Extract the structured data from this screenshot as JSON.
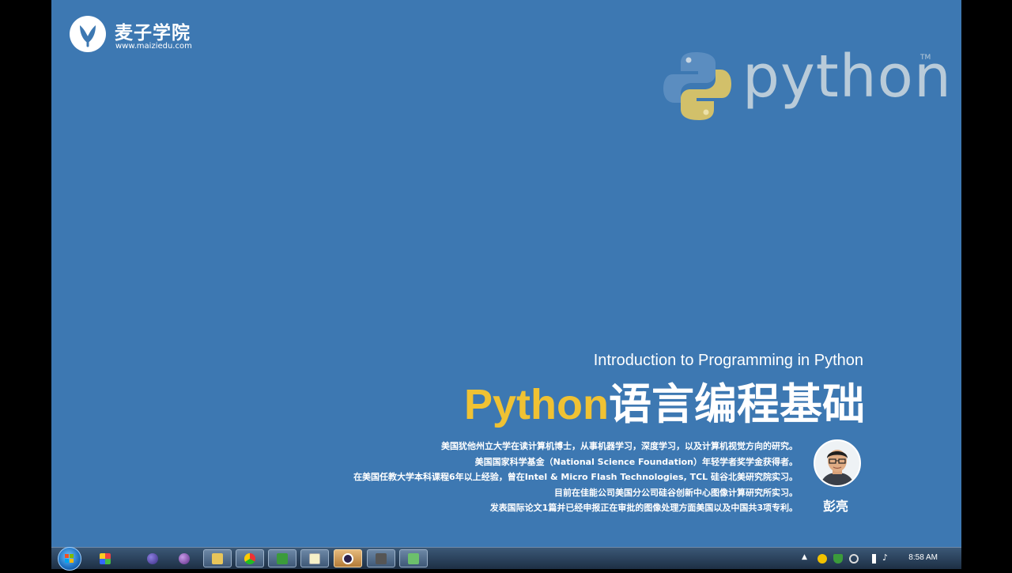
{
  "brand": {
    "name": "麦子学院",
    "url": "www.maiziedu.com"
  },
  "python_logo": {
    "word": "python",
    "tm": "TM"
  },
  "slide": {
    "subtitle": "Introduction to Programming in Python",
    "title_highlight": "Python",
    "title_rest": "语言编程基础",
    "bio": [
      "美国犹他州立大学在读计算机博士，从事机器学习，深度学习，以及计算机视觉方向的研究。",
      "美国国家科学基金（National Science Foundation）年轻学者奖学金获得者。",
      "在美国任教大学本科课程6年以上经验，曾在Intel & Micro Flash Technologies, TCL 硅谷北美研究院实习。",
      "目前在佳能公司美国分公司硅谷创新中心图像计算研究所实习。",
      "发表国际论文1篇并已经申报正在审批的图像处理方面美国以及中国共3项专利。"
    ],
    "author": "彭亮"
  },
  "taskbar": {
    "clock": "8:58 AM",
    "buttons": [
      {
        "name": "start-button",
        "icon": "windows-logo-icon"
      },
      {
        "name": "app-launcher",
        "icon": "apps-icon"
      },
      {
        "name": "eclipse",
        "icon": "eclipse-icon"
      },
      {
        "name": "eclipse-2",
        "icon": "eclipse-purple-icon"
      },
      {
        "name": "file-explorer",
        "icon": "folder-icon"
      },
      {
        "name": "chrome",
        "icon": "chrome-icon"
      },
      {
        "name": "app-green",
        "icon": "app-green-icon"
      },
      {
        "name": "notepad",
        "icon": "notepad-icon"
      },
      {
        "name": "recorder",
        "icon": "record-icon"
      },
      {
        "name": "camera",
        "icon": "camera-icon"
      },
      {
        "name": "app-green-2",
        "icon": "app-green2-icon"
      }
    ]
  },
  "colors": {
    "background": "#3d78b2",
    "python_yellow": "#f0c233"
  }
}
